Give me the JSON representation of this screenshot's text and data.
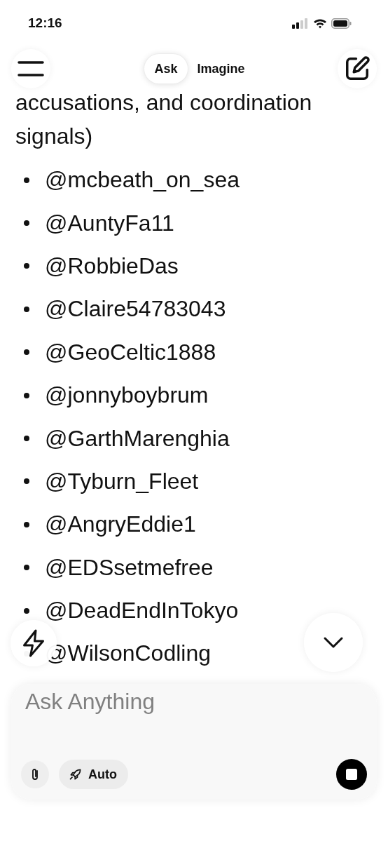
{
  "status_bar": {
    "time": "12:16"
  },
  "top_bar": {
    "tabs": [
      {
        "label": "Ask",
        "selected": true
      },
      {
        "label": "Imagine",
        "selected": false
      }
    ]
  },
  "message": {
    "paragraph_lines": [
      "accusations, and coordination",
      "signals)"
    ],
    "handles": [
      "@mcbeath_on_sea",
      "@AuntyFa11",
      "@RobbieDas",
      "@Claire54783043",
      "@GeoCeltic1888",
      "@jonnyboybrum",
      "@GarthMarenghia",
      "@Tyburn_Fleet",
      "@AngryEddie1",
      "@EDSsetmefree",
      "@DeadEndInTokyo",
      "@WilsonCodling"
    ]
  },
  "composer": {
    "placeholder": "Ask Anything",
    "mode": "Auto"
  }
}
